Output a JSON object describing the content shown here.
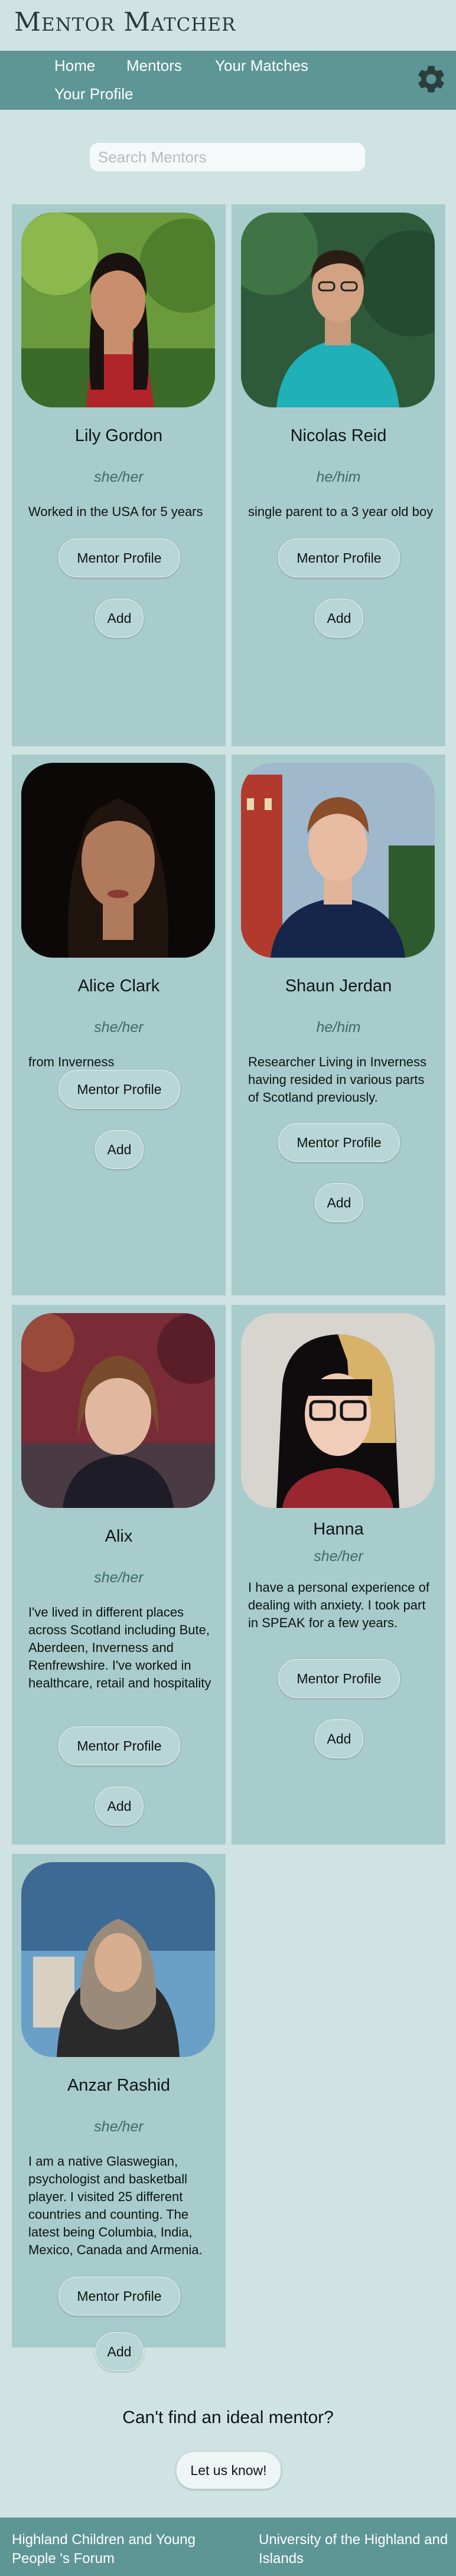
{
  "app": {
    "logo": "Mentor Matcher"
  },
  "nav": {
    "items": [
      {
        "label": "Home"
      },
      {
        "label": "Mentors"
      },
      {
        "label": "Your Matches"
      },
      {
        "label": "Your Profile"
      }
    ],
    "settings_icon": "gear-icon"
  },
  "search": {
    "placeholder": "Search Mentors",
    "value": ""
  },
  "mentors": [
    {
      "name": "Lily Gordon",
      "pronouns": "she/her",
      "bio": "Worked in the USA for 5 years",
      "profile_label": "Mentor Profile",
      "add_label": "Add"
    },
    {
      "name": "Nicolas Reid",
      "pronouns": "he/him",
      "bio": "single parent to a 3 year old boy",
      "profile_label": "Mentor Profile",
      "add_label": "Add"
    },
    {
      "name": "Alice Clark",
      "pronouns": "she/her",
      "bio": "from Inverness",
      "profile_label": "Mentor Profile",
      "add_label": "Add"
    },
    {
      "name": "Shaun Jerdan",
      "pronouns": "he/him",
      "bio": "Researcher Living in Inverness having resided in various parts of Scotland previously.",
      "profile_label": "Mentor Profile",
      "add_label": "Add"
    },
    {
      "name": "Alix",
      "pronouns": "she/her",
      "bio": "I've lived in different places across Scotland including Bute, Aberdeen, Inverness and Renfrewshire. I've worked in healthcare, retail and hospitality",
      "profile_label": "Mentor Profile",
      "add_label": "Add"
    },
    {
      "name": "Hanna",
      "pronouns": "she/her",
      "bio": "I have a personal experience of dealing with anxiety. I took part in SPEAK for a few years.",
      "profile_label": "Mentor Profile",
      "add_label": "Add"
    },
    {
      "name": "Anzar Rashid",
      "pronouns": "she/her",
      "bio": "I am a native Glaswegian, psychologist and basketball player. I visited 25 different countries and counting. The latest being Columbia, India, Mexico, Canada and Armenia.",
      "profile_label": "Mentor Profile",
      "add_label": "Add"
    }
  ],
  "cta": {
    "text": "Can't find an ideal mentor?",
    "button_label": "Let us know!"
  },
  "footer": {
    "left_link": "Highland Children and Young People 's Forum",
    "right_link": "University of the Highland and Islands"
  },
  "colors": {
    "page_bg": "#cfe3e3",
    "nav_bg": "#5e9696",
    "card_bg": "#a8cbcb",
    "pronoun_text": "#3e6a6a"
  }
}
